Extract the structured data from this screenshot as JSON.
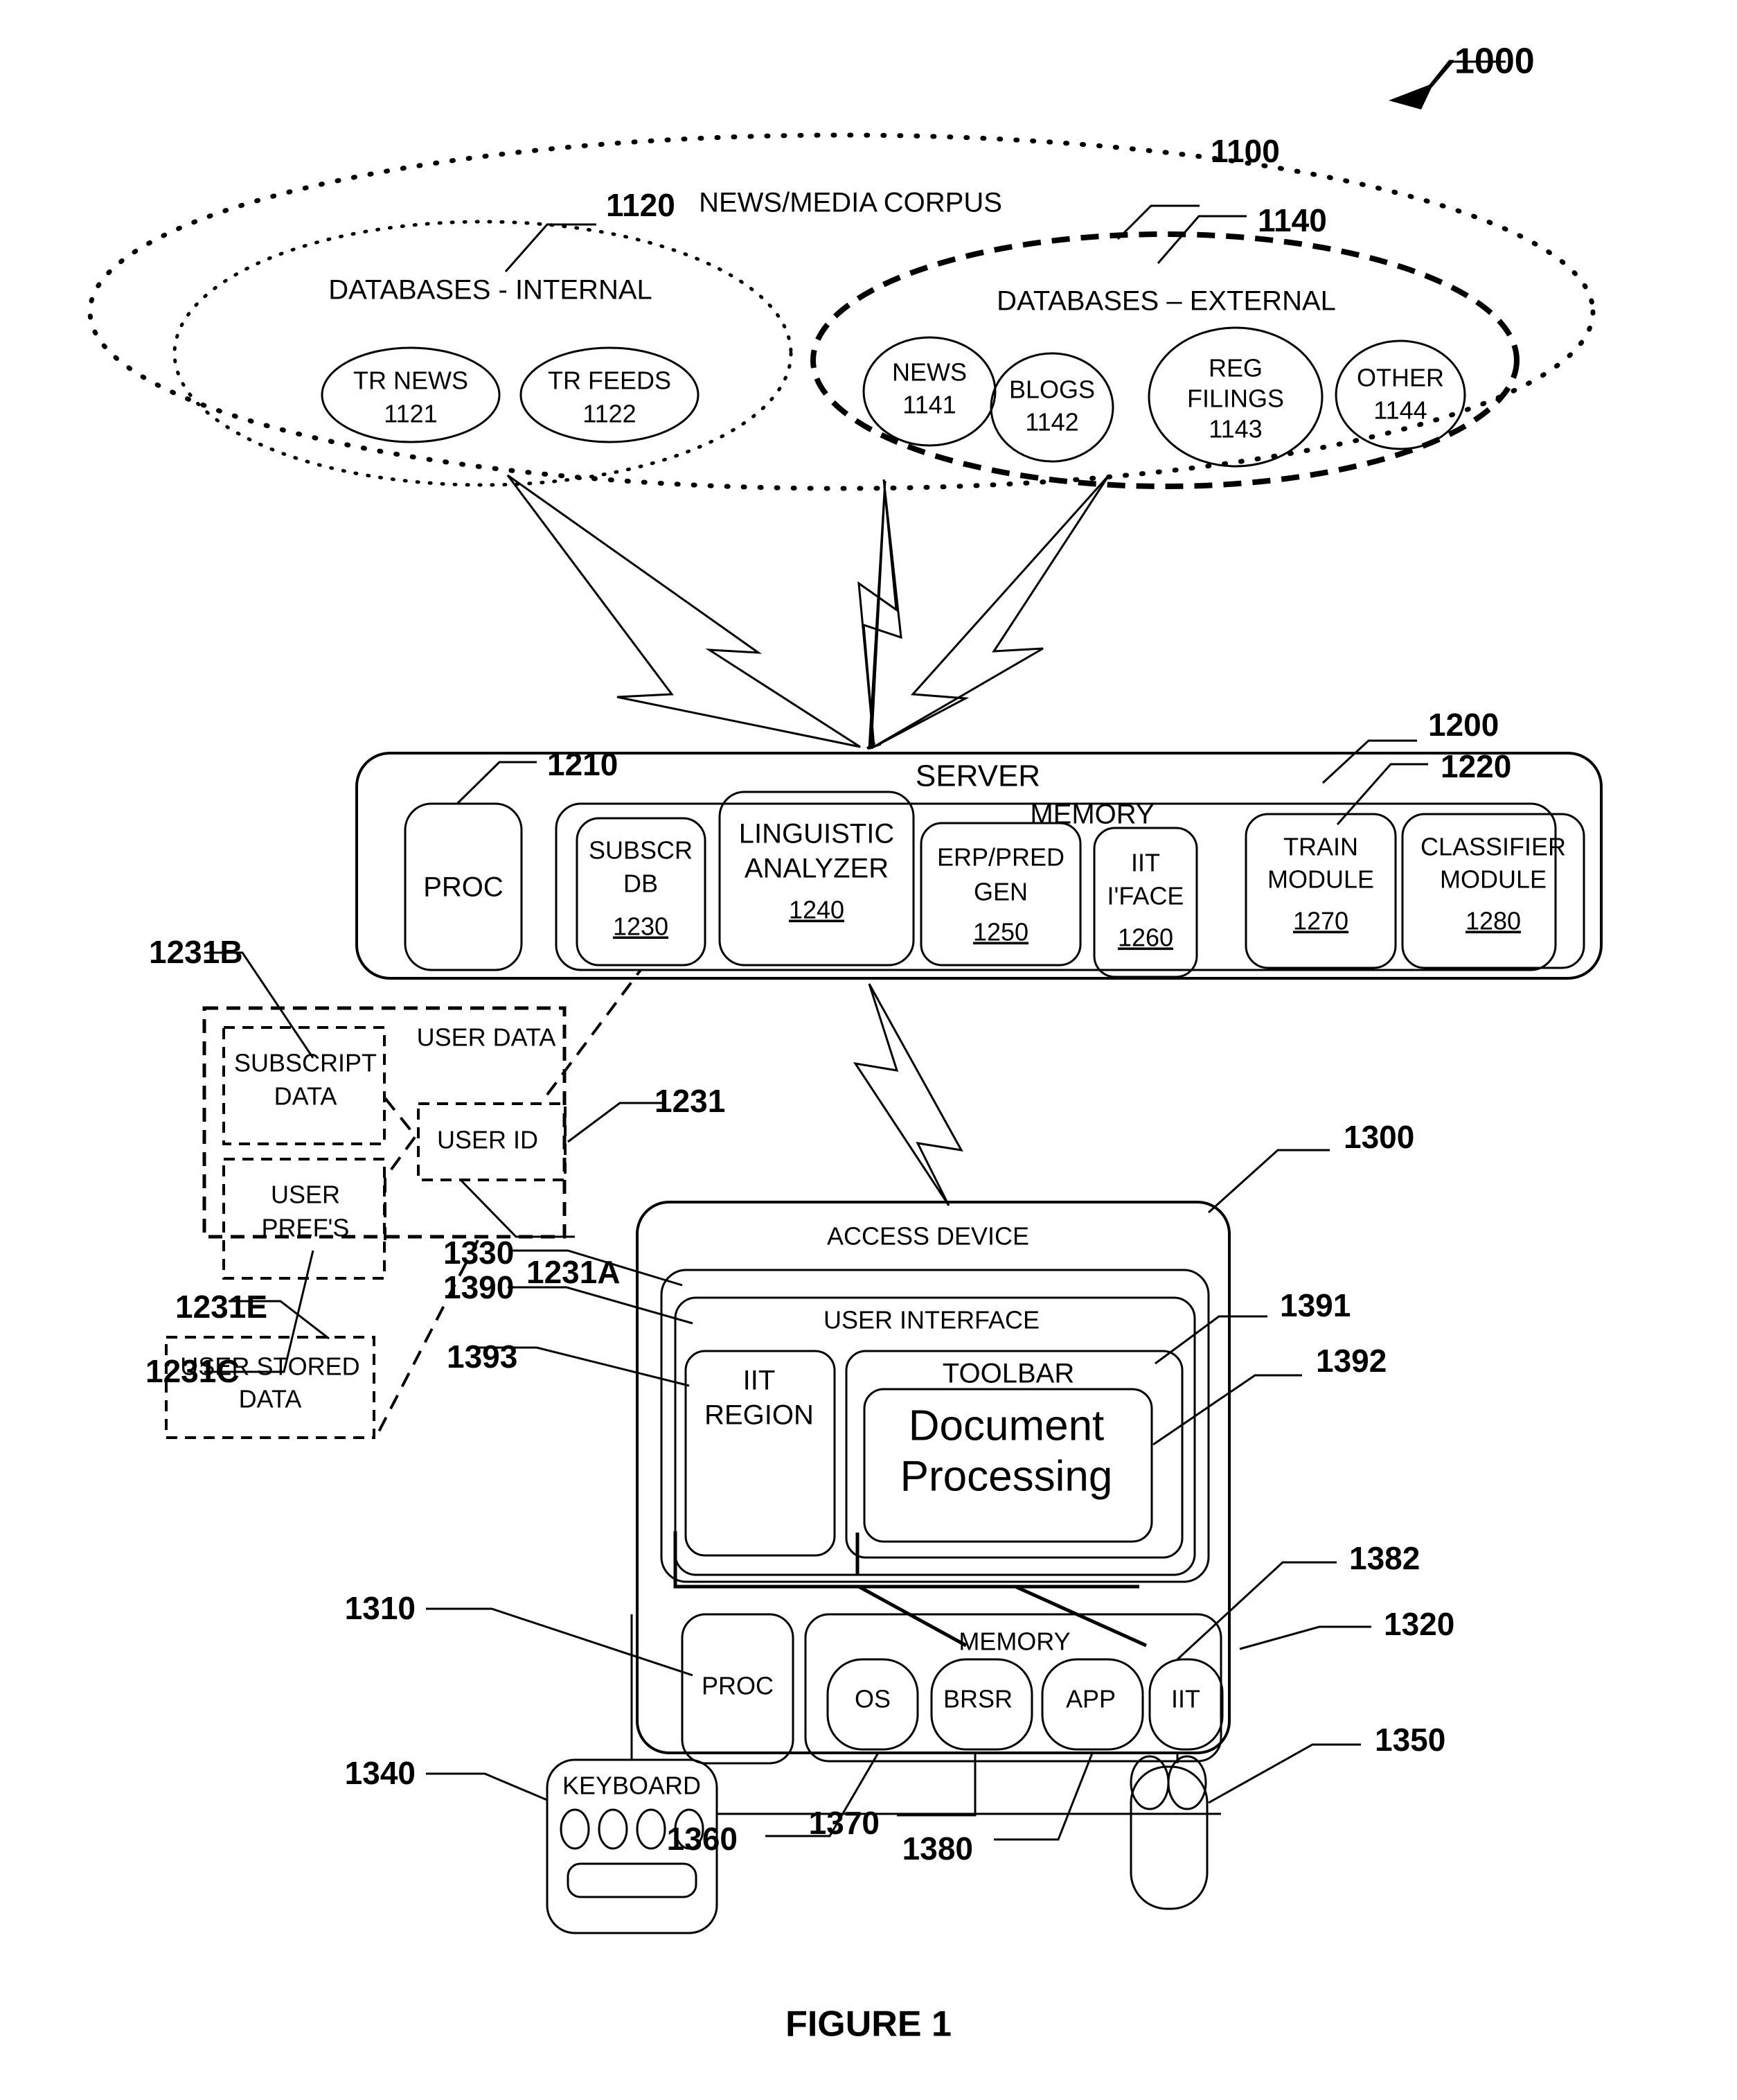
{
  "figure": {
    "caption": "FIGURE 1",
    "system_ref": "1000"
  },
  "corpus": {
    "ref": "1100",
    "title": "NEWS/MEDIA CORPUS",
    "internal": {
      "ref": "1120",
      "title": "DATABASES - INTERNAL",
      "nodes": [
        {
          "label": "TR NEWS",
          "ref": "1121"
        },
        {
          "label": "TR FEEDS",
          "ref": "1122"
        }
      ]
    },
    "external": {
      "ref": "1140",
      "title": "DATABASES – EXTERNAL",
      "nodes": [
        {
          "label": "NEWS",
          "ref": "1141"
        },
        {
          "label": "BLOGS",
          "ref": "1142"
        },
        {
          "label1": "REG",
          "label2": "FILINGS",
          "ref": "1143"
        },
        {
          "label": "OTHER",
          "ref": "1144"
        }
      ]
    }
  },
  "server": {
    "ref": "1200",
    "title": "SERVER",
    "proc": {
      "label": "PROC",
      "ref": "1210"
    },
    "memory": {
      "label": "MEMORY",
      "ref": "1220"
    },
    "modules": [
      {
        "line1": "SUBSCR",
        "line2": "DB",
        "ref": "1230"
      },
      {
        "line1": "LINGUISTIC",
        "line2": "ANALYZER",
        "ref": "1240"
      },
      {
        "line1": "ERP/PRED",
        "line2": "GEN",
        "ref": "1250"
      },
      {
        "line1": "IIT",
        "line2": "I'FACE",
        "ref": "1260"
      },
      {
        "line1": "TRAIN",
        "line2": "MODULE",
        "ref": "1270"
      },
      {
        "line1": "CLASSIFIER",
        "line2": "MODULE",
        "ref": "1280"
      }
    ]
  },
  "user_data": {
    "title": "USER DATA",
    "ref": "1231",
    "subscript": {
      "line1": "SUBSCRIPT",
      "line2": "DATA",
      "ref": "1231B"
    },
    "user_prefs": {
      "line1": "USER",
      "line2": "PREF'S",
      "ref": "1231C"
    },
    "user_id": {
      "label": "USER ID",
      "ref": "1231A"
    },
    "user_stored": {
      "line1": "USER STORED",
      "line2": "DATA",
      "ref": "1231E"
    }
  },
  "access_device": {
    "ref": "1300",
    "title": "ACCESS DEVICE",
    "display_ref": "1330",
    "ui": {
      "ref": "1390",
      "title": "USER INTERFACE"
    },
    "iit_region": {
      "line1": "IIT",
      "line2": "REGION",
      "ref": "1393"
    },
    "toolbar": {
      "label": "TOOLBAR",
      "ref": "1391"
    },
    "document": {
      "line1": "Document",
      "line2": "Processing",
      "ref": "1392"
    },
    "proc": {
      "label": "PROC",
      "ref": "1310"
    },
    "memory": {
      "label": "MEMORY",
      "ref": "1320"
    },
    "apps": [
      {
        "label": "OS",
        "ref": "1360"
      },
      {
        "label": "BRSR",
        "ref": "1370"
      },
      {
        "label": "APP",
        "ref": "1380"
      },
      {
        "label": "IIT",
        "ref": "1382"
      }
    ],
    "keyboard": {
      "label": "KEYBOARD",
      "ref": "1340"
    },
    "mouse": {
      "ref": "1350"
    }
  }
}
